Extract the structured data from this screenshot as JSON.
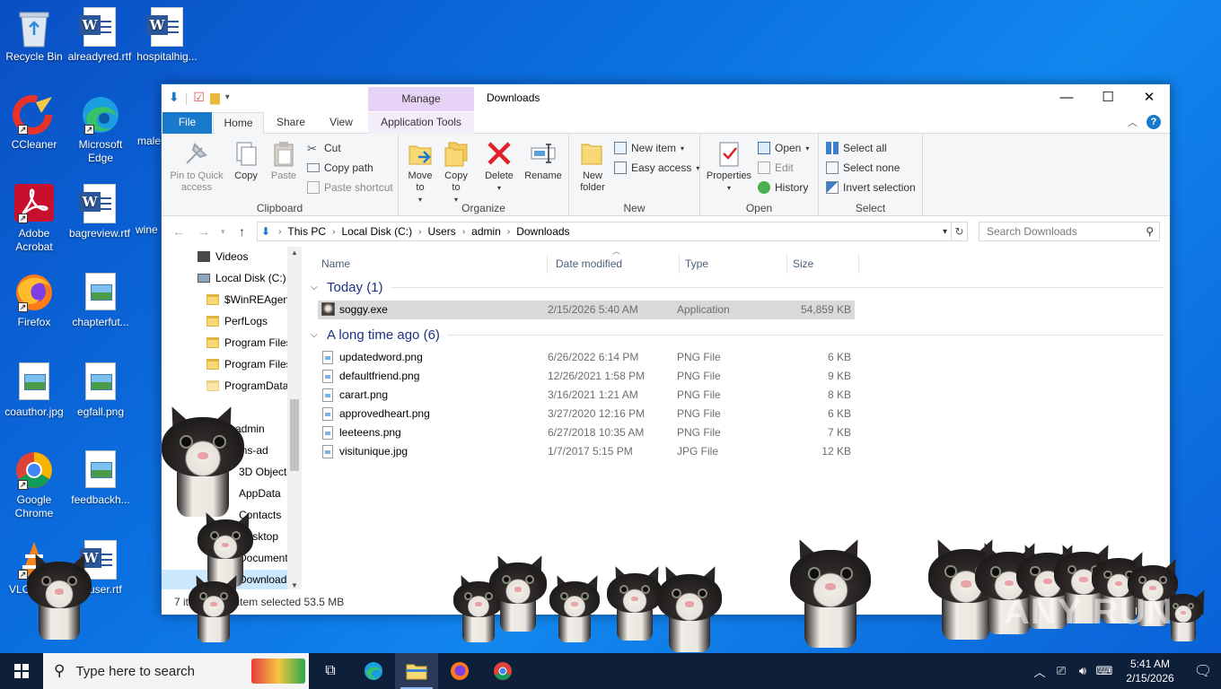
{
  "desktop": {
    "icons": [
      {
        "label": "Recycle Bin"
      },
      {
        "label": "alreadyred.rtf"
      },
      {
        "label": "hospitalhig..."
      },
      {
        "label": "CCleaner"
      },
      {
        "label": "Microsoft Edge"
      },
      {
        "label": "male"
      },
      {
        "label": "Adobe Acrobat"
      },
      {
        "label": "bagreview.rtf"
      },
      {
        "label": "wine"
      },
      {
        "label": "Firefox"
      },
      {
        "label": "chapterfut..."
      },
      {
        "label": "coauthor.jpg"
      },
      {
        "label": "egfall.png"
      },
      {
        "label": "Google Chrome"
      },
      {
        "label": "feedbackh..."
      },
      {
        "label": "VLC m pla"
      },
      {
        "label": "rduser.rtf"
      }
    ]
  },
  "window": {
    "title": "Downloads",
    "contextual_tab": "Manage",
    "tabs": {
      "file": "File",
      "home": "Home",
      "share": "Share",
      "view": "View",
      "app_tools": "Application Tools"
    },
    "ribbon": {
      "clipboard": {
        "label": "Clipboard",
        "pin": "Pin to Quick access",
        "copy": "Copy",
        "paste": "Paste",
        "cut": "Cut",
        "copy_path": "Copy path",
        "paste_shortcut": "Paste shortcut"
      },
      "organize": {
        "label": "Organize",
        "move_to": "Move to",
        "copy_to": "Copy to",
        "delete": "Delete",
        "rename": "Rename"
      },
      "new": {
        "label": "New",
        "new_folder": "New folder",
        "new_item": "New item",
        "easy_access": "Easy access"
      },
      "open": {
        "label": "Open",
        "properties": "Properties",
        "open": "Open",
        "edit": "Edit",
        "history": "History"
      },
      "select": {
        "label": "Select",
        "select_all": "Select all",
        "select_none": "Select none",
        "invert": "Invert selection"
      }
    },
    "address": {
      "crumbs": [
        "This PC",
        "Local Disk (C:)",
        "Users",
        "admin",
        "Downloads"
      ],
      "search_placeholder": "Search Downloads"
    },
    "navpane": [
      {
        "label": "Videos"
      },
      {
        "label": "Local Disk (C:)"
      },
      {
        "label": "$WinREAgent"
      },
      {
        "label": "PerfLogs"
      },
      {
        "label": "Program Files"
      },
      {
        "label": "Program Files"
      },
      {
        "label": "ProgramData"
      },
      {
        "label": "admin"
      },
      {
        "label": ".ms-ad"
      },
      {
        "label": "3D Objects"
      },
      {
        "label": "AppData"
      },
      {
        "label": "Contacts"
      },
      {
        "label": "Desktop"
      },
      {
        "label": "Documents"
      },
      {
        "label": "Downloads"
      }
    ],
    "columns": {
      "name": "Name",
      "date": "Date modified",
      "type": "Type",
      "size": "Size"
    },
    "groups": [
      {
        "title": "Today (1)",
        "files": [
          {
            "name": "soggy.exe",
            "date": "2/15/2026 5:40 AM",
            "type": "Application",
            "size": "54,859 KB"
          }
        ]
      },
      {
        "title": "A long time ago (6)",
        "files": [
          {
            "name": "updatedword.png",
            "date": "6/26/2022 6:14 PM",
            "type": "PNG File",
            "size": "6 KB"
          },
          {
            "name": "defaultfriend.png",
            "date": "12/26/2021 1:58 PM",
            "type": "PNG File",
            "size": "9 KB"
          },
          {
            "name": "carart.png",
            "date": "3/16/2021 1:21 AM",
            "type": "PNG File",
            "size": "8 KB"
          },
          {
            "name": "approvedheart.png",
            "date": "3/27/2020 12:16 PM",
            "type": "PNG File",
            "size": "6 KB"
          },
          {
            "name": "leeteens.png",
            "date": "6/27/2018 10:35 AM",
            "type": "PNG File",
            "size": "7 KB"
          },
          {
            "name": "visitunique.jpg",
            "date": "1/7/2017 5:15 PM",
            "type": "JPG File",
            "size": "12 KB"
          }
        ]
      }
    ],
    "status": {
      "count": "7 items",
      "selected": "1 item selected  53.5 MB"
    }
  },
  "watermark": "ANY RUN",
  "taskbar": {
    "search_placeholder": "Type here to search",
    "time": "5:41 AM",
    "date": "2/15/2026"
  }
}
